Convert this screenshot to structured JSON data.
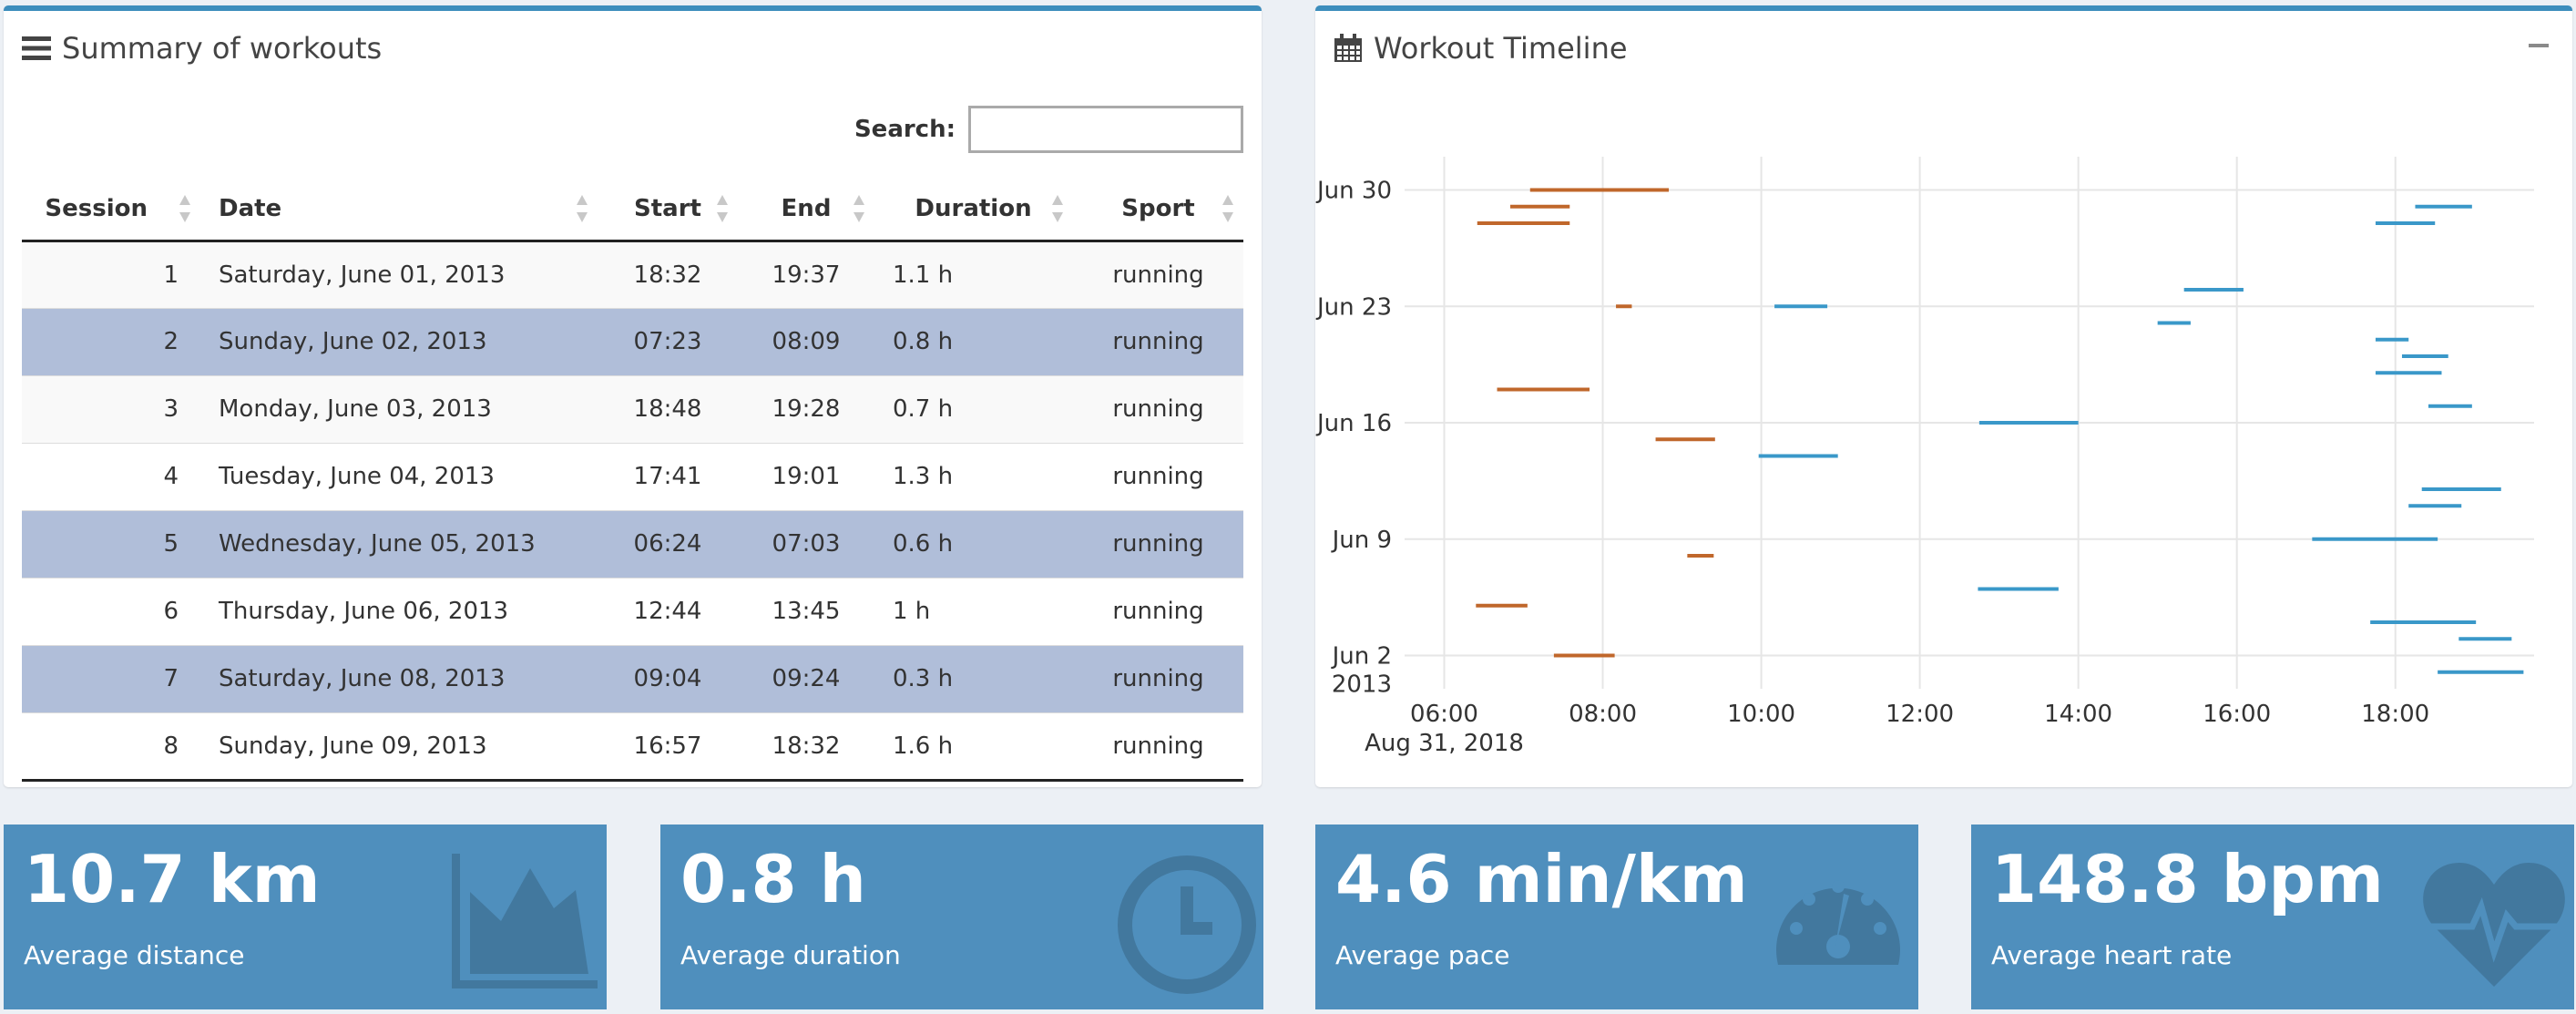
{
  "summary": {
    "title": "Summary of workouts",
    "search_label": "Search:",
    "search_value": "",
    "columns": [
      "Session",
      "Date",
      "Start",
      "End",
      "Duration",
      "Sport"
    ],
    "rows": [
      {
        "session": "1",
        "date": "Saturday, June 01, 2013",
        "start": "18:32",
        "end": "19:37",
        "duration": "1.1 h",
        "sport": "running",
        "selected": false
      },
      {
        "session": "2",
        "date": "Sunday, June 02, 2013",
        "start": "07:23",
        "end": "08:09",
        "duration": "0.8 h",
        "sport": "running",
        "selected": true
      },
      {
        "session": "3",
        "date": "Monday, June 03, 2013",
        "start": "18:48",
        "end": "19:28",
        "duration": "0.7 h",
        "sport": "running",
        "selected": false
      },
      {
        "session": "4",
        "date": "Tuesday, June 04, 2013",
        "start": "17:41",
        "end": "19:01",
        "duration": "1.3 h",
        "sport": "running",
        "selected": false
      },
      {
        "session": "5",
        "date": "Wednesday, June 05, 2013",
        "start": "06:24",
        "end": "07:03",
        "duration": "0.6 h",
        "sport": "running",
        "selected": true
      },
      {
        "session": "6",
        "date": "Thursday, June 06, 2013",
        "start": "12:44",
        "end": "13:45",
        "duration": "1 h",
        "sport": "running",
        "selected": false
      },
      {
        "session": "7",
        "date": "Saturday, June 08, 2013",
        "start": "09:04",
        "end": "09:24",
        "duration": "0.3 h",
        "sport": "running",
        "selected": true
      },
      {
        "session": "8",
        "date": "Sunday, June 09, 2013",
        "start": "16:57",
        "end": "18:32",
        "duration": "1.6 h",
        "sport": "running",
        "selected": false
      }
    ]
  },
  "timeline": {
    "title": "Workout Timeline",
    "chart_data": {
      "type": "timeline",
      "title": "",
      "x_ticks": [
        "06:00",
        "08:00",
        "10:00",
        "12:00",
        "14:00",
        "16:00",
        "18:00"
      ],
      "x_sublabel": "Aug 31, 2018",
      "x_range": [
        "05:30",
        "19:45"
      ],
      "y_ticks": [
        "Jun 30",
        "Jun 23",
        "Jun 16",
        "Jun 9",
        "Jun 2"
      ],
      "y_sublabel": "2013",
      "y_range": [
        "2013-05-31",
        "2013-07-02"
      ],
      "grid": true,
      "colors": {
        "morning": "#c0672b",
        "afternoon": "#3a98c9"
      },
      "series": [
        {
          "color_key": "morning",
          "segments": [
            {
              "date": "2013-06-30",
              "start": "07:05",
              "end": "08:50"
            },
            {
              "date": "2013-06-29",
              "start": "06:50",
              "end": "07:35"
            },
            {
              "date": "2013-06-28",
              "start": "06:25",
              "end": "07:35"
            },
            {
              "date": "2013-06-23",
              "start": "08:10",
              "end": "08:22"
            },
            {
              "date": "2013-06-18",
              "start": "06:40",
              "end": "07:50"
            },
            {
              "date": "2013-06-15",
              "start": "08:40",
              "end": "09:25"
            },
            {
              "date": "2013-06-08",
              "start": "09:04",
              "end": "09:24"
            },
            {
              "date": "2013-06-05",
              "start": "06:24",
              "end": "07:03"
            },
            {
              "date": "2013-06-02",
              "start": "07:23",
              "end": "08:09"
            }
          ]
        },
        {
          "color_key": "afternoon",
          "segments": [
            {
              "date": "2013-06-29",
              "start": "18:15",
              "end": "18:58"
            },
            {
              "date": "2013-06-28",
              "start": "17:45",
              "end": "18:30"
            },
            {
              "date": "2013-06-24",
              "start": "15:20",
              "end": "16:05"
            },
            {
              "date": "2013-06-23",
              "start": "10:10",
              "end": "10:50"
            },
            {
              "date": "2013-06-22",
              "start": "15:00",
              "end": "15:25"
            },
            {
              "date": "2013-06-21",
              "start": "17:45",
              "end": "18:10"
            },
            {
              "date": "2013-06-20",
              "start": "18:05",
              "end": "18:40"
            },
            {
              "date": "2013-06-19",
              "start": "17:45",
              "end": "18:35"
            },
            {
              "date": "2013-06-17",
              "start": "18:25",
              "end": "18:58"
            },
            {
              "date": "2013-06-16",
              "start": "12:45",
              "end": "14:00"
            },
            {
              "date": "2013-06-14",
              "start": "09:58",
              "end": "10:58"
            },
            {
              "date": "2013-06-12",
              "start": "18:20",
              "end": "19:20"
            },
            {
              "date": "2013-06-11",
              "start": "18:10",
              "end": "18:50"
            },
            {
              "date": "2013-06-09",
              "start": "16:57",
              "end": "18:32"
            },
            {
              "date": "2013-06-06",
              "start": "12:44",
              "end": "13:45"
            },
            {
              "date": "2013-06-04",
              "start": "17:41",
              "end": "19:01"
            },
            {
              "date": "2013-06-03",
              "start": "18:48",
              "end": "19:28"
            },
            {
              "date": "2013-06-01",
              "start": "18:32",
              "end": "19:37"
            }
          ]
        }
      ]
    }
  },
  "stats": [
    {
      "value": "10.7 km",
      "label": "Average distance",
      "icon": "area-chart-icon"
    },
    {
      "value": "0.8 h",
      "label": "Average duration",
      "icon": "clock-icon"
    },
    {
      "value": "4.6 min/km",
      "label": "Average pace",
      "icon": "dashboard-icon"
    },
    {
      "value": "148.8 bpm",
      "label": "Average heart rate",
      "icon": "heartbeat-icon"
    }
  ]
}
